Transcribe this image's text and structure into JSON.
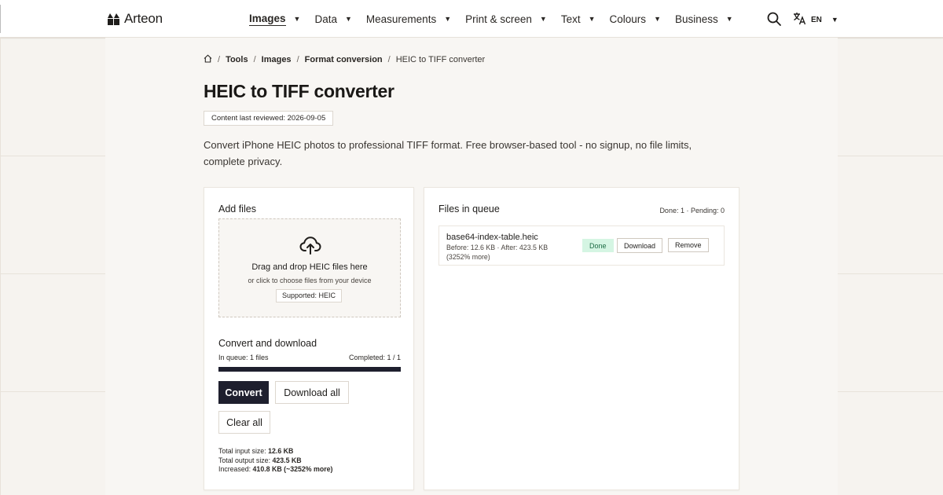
{
  "brand": {
    "name": "Arteon"
  },
  "nav": {
    "items": [
      {
        "label": "Images",
        "active": true
      },
      {
        "label": "Data"
      },
      {
        "label": "Measurements"
      },
      {
        "label": "Print & screen"
      },
      {
        "label": "Text"
      },
      {
        "label": "Colours"
      },
      {
        "label": "Business"
      }
    ],
    "caret": "▼",
    "language": "EN",
    "icons": {
      "search": "search-icon",
      "translate": "translate-icon",
      "home": "home-icon"
    }
  },
  "breadcrumb": {
    "sep": "/",
    "items": [
      "Tools",
      "Images",
      "Format conversion"
    ],
    "current": "HEIC to TIFF converter"
  },
  "page": {
    "title": "HEIC to TIFF converter",
    "review_badge": "Content last reviewed: 2026-09-05",
    "intro": "Convert iPhone HEIC photos to professional TIFF format. Free browser-based tool - no signup, no file limits, complete privacy."
  },
  "add_files": {
    "title": "Add files",
    "dropzone_title": "Drag and drop HEIC files here",
    "dropzone_sub": "or click to choose files from your device",
    "supported": "Supported: HEIC",
    "icon": "cloud-upload-icon"
  },
  "convert": {
    "title": "Convert and download",
    "in_queue": "In queue: 1 files",
    "completed": "Completed: 1 / 1",
    "progress": 1.0,
    "convert_label": "Convert",
    "download_all_label": "Download all",
    "clear_all_label": "Clear all",
    "summary": {
      "input_label": "Total input size:",
      "input_value": "12.6 KB",
      "output_label": "Total output size:",
      "output_value": "423.5 KB",
      "increase_label": "Increased:",
      "increase_value": "410.8 KB (~3252% more)"
    }
  },
  "queue": {
    "title": "Files in queue",
    "count": "Done: 1 · Pending: 0",
    "files": [
      {
        "name": "base64-index-table.heic",
        "meta": "Before: 12.6 KB · After: 423.5 KB (3252% more)",
        "status": "Done",
        "download_label": "Download",
        "remove_label": "Remove"
      }
    ]
  },
  "colors": {
    "primary": "#1e1f2e",
    "done_bg": "#d5f5e3",
    "done_text": "#1c6b44",
    "page_bg": "#f6f3ef"
  }
}
